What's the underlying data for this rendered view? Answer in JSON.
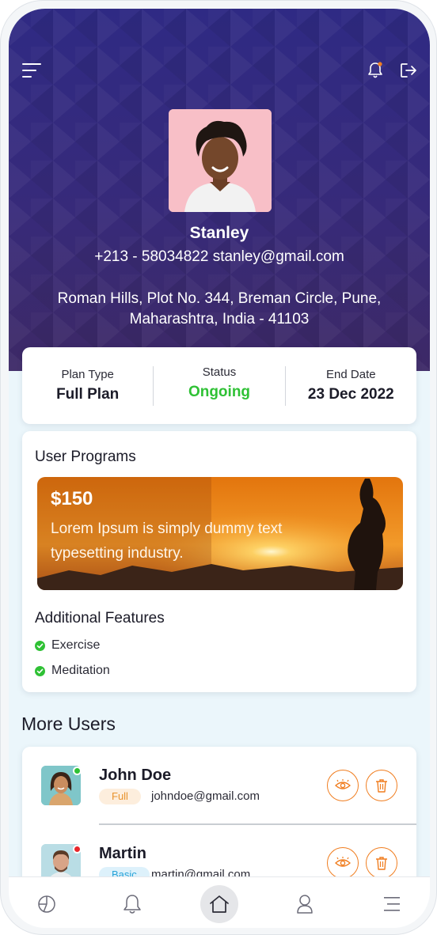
{
  "header": {
    "menu_icon": "hamburger-icon",
    "notification_icon": "bell-icon",
    "logout_icon": "logout-icon"
  },
  "profile": {
    "name": "Stanley",
    "contact": "+213 - 58034822 stanley@gmail.com",
    "address": "Roman Hills, Plot No. 344, Breman Circle, Pune, Maharashtra, India - 41103"
  },
  "plan": {
    "plan_type_label": "Plan Type",
    "plan_type_value": "Full Plan",
    "status_label": "Status",
    "status_value": "Ongoing",
    "end_date_label": "End Date",
    "end_date_value": "23 Dec 2022"
  },
  "programs": {
    "title": "User Programs",
    "banner_price": "$150",
    "banner_text": "Lorem Ipsum is simply dummy text typesetting industry.",
    "features_title": "Additional Features",
    "features": [
      "Exercise",
      "Meditation"
    ]
  },
  "more_users": {
    "title": "More Users",
    "users": [
      {
        "name": "John Doe",
        "plan": "Full",
        "email": "johndoe@gmail.com",
        "online_color": "#2fc135"
      },
      {
        "name": "Martin",
        "plan": "Basic",
        "email": "martin@gmail.com",
        "online_color": "#e8262b"
      }
    ]
  },
  "colors": {
    "hero": "#332a80",
    "accent_orange": "#f07d1f",
    "status_green": "#2fc135"
  },
  "bottom_nav": [
    "dashboard-icon",
    "bell-icon",
    "home-icon",
    "user-icon",
    "menu-icon"
  ]
}
